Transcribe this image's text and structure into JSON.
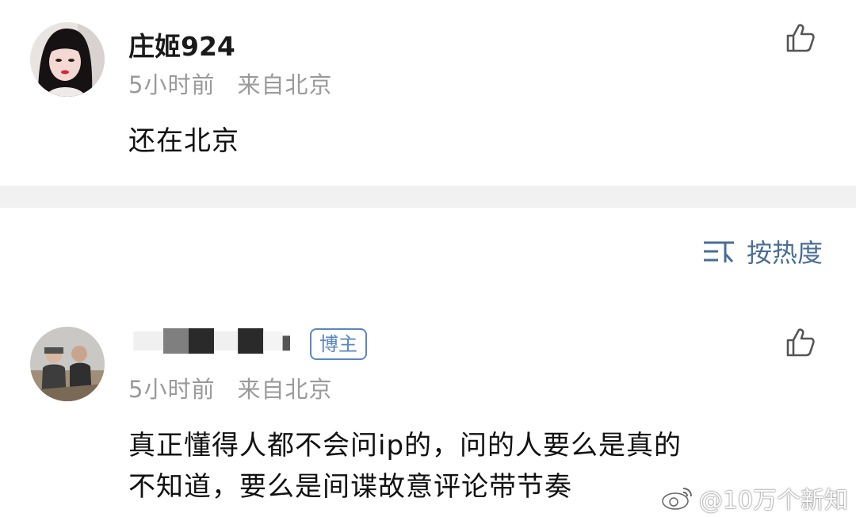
{
  "comments": [
    {
      "username": "庄姬924",
      "time": "5小时前",
      "location": "来自北京",
      "text": "还在北京",
      "avatar_icon": "user-avatar-photo",
      "like_icon": "thumbs-up-icon"
    },
    {
      "username": "",
      "badge": "博主",
      "time": "5小时前",
      "location": "来自北京",
      "text_lines": [
        "真正懂得人都不会问ip的，问的人要么是真的",
        "不知道，要么是间谍故意评论带节奏"
      ],
      "avatar_icon": "user-avatar-photo",
      "like_icon": "thumbs-up-icon"
    }
  ],
  "sort": {
    "label": "按热度",
    "icon": "sort-icon"
  },
  "watermark": {
    "text": "@10万个新知",
    "icon": "weibo-logo"
  },
  "colors": {
    "link_blue": "#4a6e95",
    "badge_blue": "#5a86c2",
    "meta_gray": "#9a9a9a",
    "divider_gray": "#f1f1f1"
  }
}
